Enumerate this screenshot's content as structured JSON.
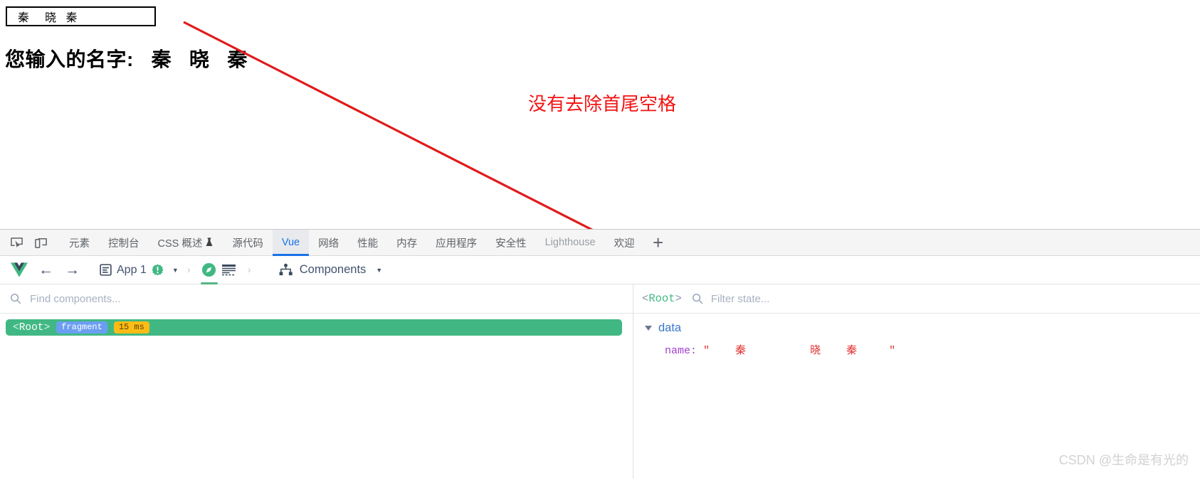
{
  "page": {
    "input_value": "  秦     晓   秦 ",
    "input_placeholder": "",
    "result_label": "您输入的名字:   秦   晓   秦",
    "annotation": "没有去除首尾空格"
  },
  "devtools": {
    "left_icons": [
      {
        "name": "inspect-element-icon"
      },
      {
        "name": "device-toolbar-icon"
      }
    ],
    "tabs": [
      {
        "label": "元素",
        "active": false,
        "faded": false
      },
      {
        "label": "控制台",
        "active": false,
        "faded": false
      },
      {
        "label": "CSS 概述",
        "active": false,
        "faded": false,
        "icon": "flask-icon"
      },
      {
        "label": "源代码",
        "active": false,
        "faded": false
      },
      {
        "label": "Vue",
        "active": true,
        "faded": false
      },
      {
        "label": "网络",
        "active": false,
        "faded": false
      },
      {
        "label": "性能",
        "active": false,
        "faded": false
      },
      {
        "label": "内存",
        "active": false,
        "faded": false
      },
      {
        "label": "应用程序",
        "active": false,
        "faded": false
      },
      {
        "label": "安全性",
        "active": false,
        "faded": false
      },
      {
        "label": "Lighthouse",
        "active": false,
        "faded": true
      },
      {
        "label": "欢迎",
        "active": false,
        "faded": false
      }
    ],
    "add_tab_label": "+"
  },
  "vue_toolbar": {
    "back_arrow": "←",
    "forward_arrow": "→",
    "app_label": "App 1",
    "app_badge_icon": "warning-badge-icon",
    "app_caret": "▼",
    "separator": "›",
    "compass_icon": "compass-icon",
    "grid_icon": "grid-icon",
    "components_label": "Components",
    "components_caret": "▼"
  },
  "component_tree": {
    "search_placeholder": "Find components...",
    "search_value": "",
    "rows": [
      {
        "open_bracket": "<",
        "tag": "Root",
        "close_bracket": ">",
        "badge_type": "fragment",
        "badge_time": "15 ms",
        "selected": true
      }
    ]
  },
  "state_panel": {
    "root_open": "<",
    "root_name": "Root",
    "root_close": ">",
    "filter_placeholder": "Filter state...",
    "filter_value": "",
    "groups": [
      {
        "label": "data",
        "expanded": true,
        "props": [
          {
            "key": "name",
            "colon": ":",
            "value": "\"    秦          晓    秦     \""
          }
        ]
      }
    ]
  },
  "watermark": "CSDN @生命是有光的",
  "colors": {
    "vue_green": "#41b883",
    "accent_blue": "#1a73e8",
    "annotation_red": "#f31414",
    "arrow_red": "#e01b1b",
    "string_red": "#e03030",
    "key_purple": "#a23fd0"
  }
}
